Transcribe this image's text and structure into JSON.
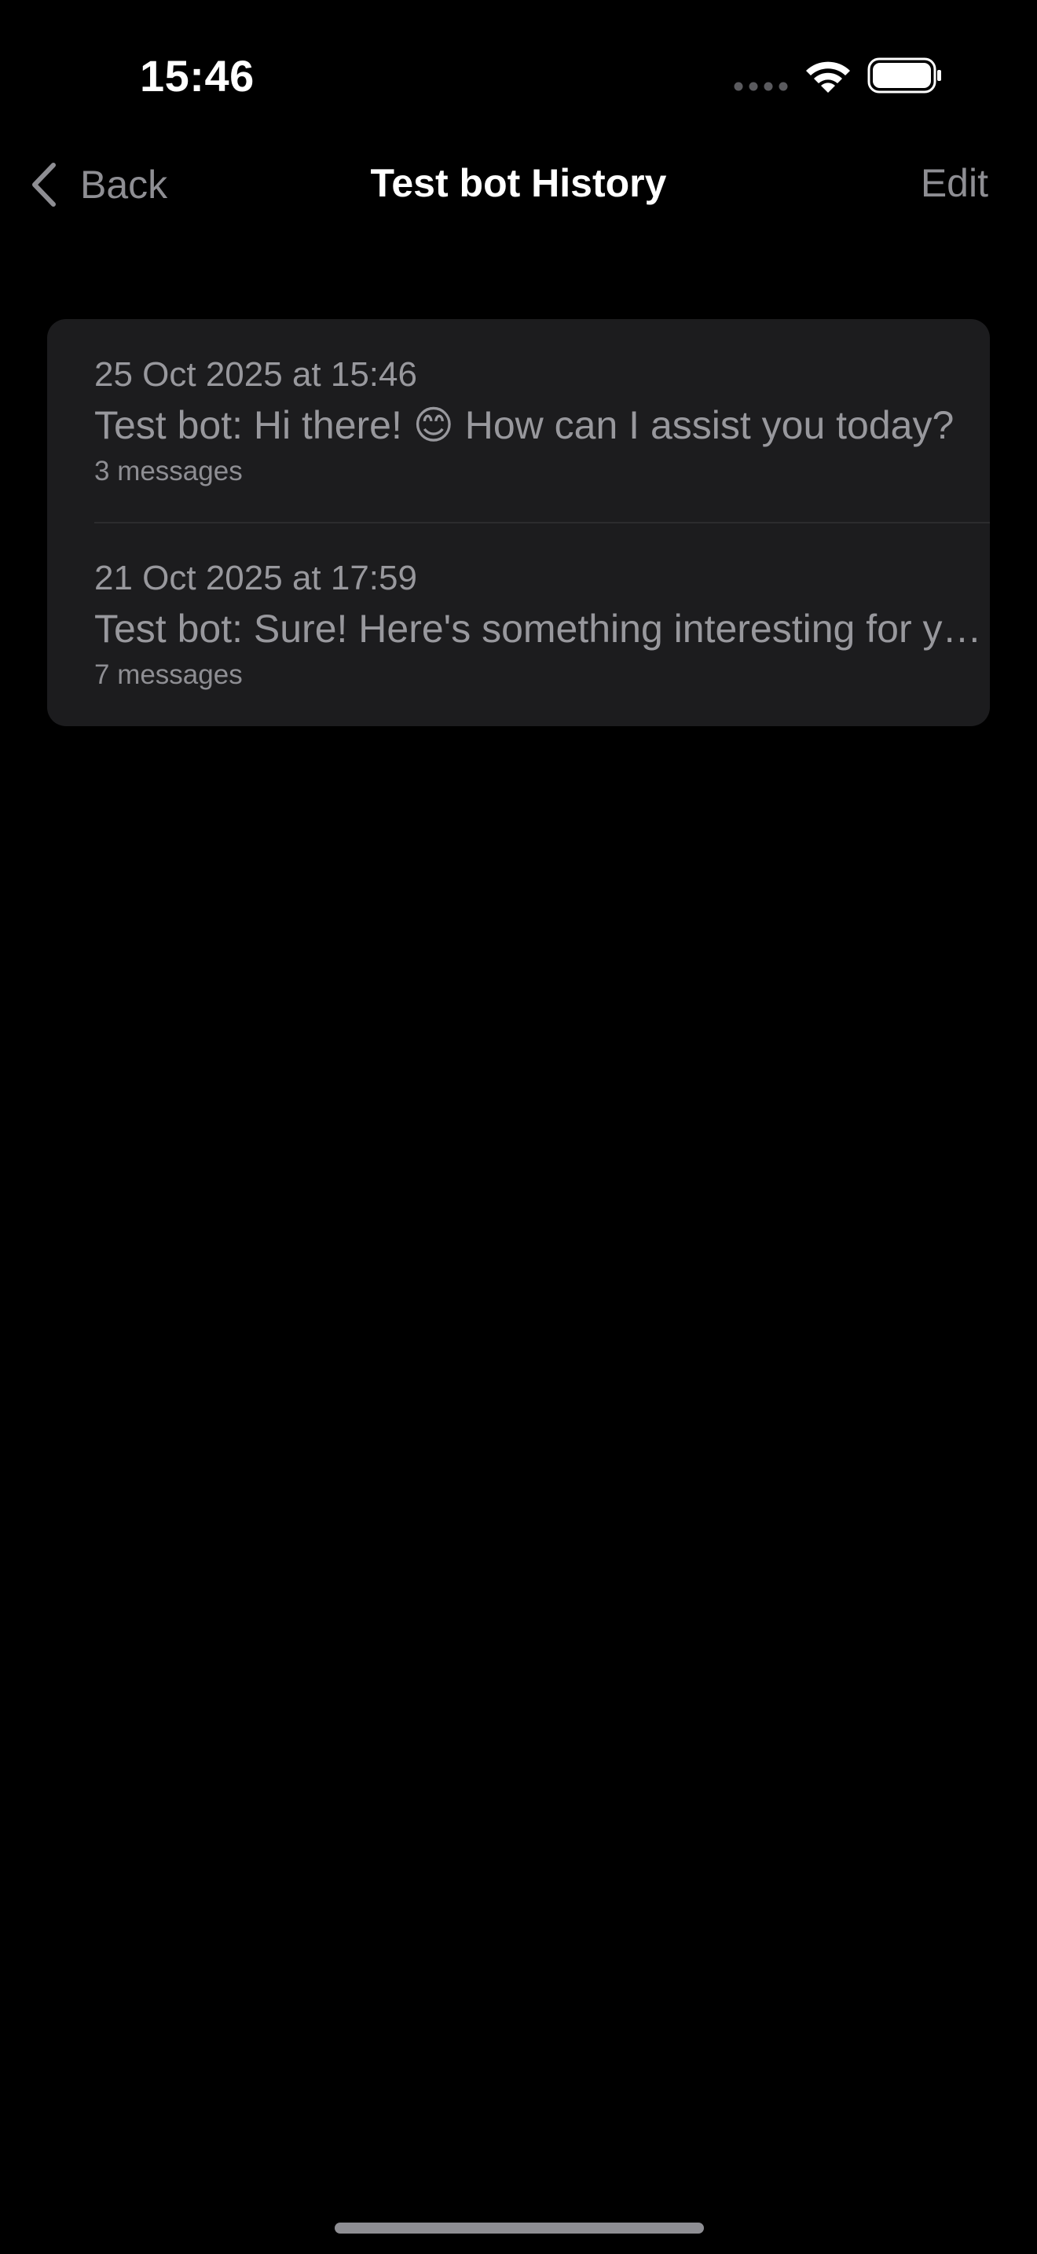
{
  "status_bar": {
    "time": "15:46",
    "icons": [
      "cellular-signal-icon",
      "wifi-icon",
      "battery-icon"
    ]
  },
  "nav": {
    "back_label": "Back",
    "title": "Test bot History",
    "edit_label": "Edit"
  },
  "history": {
    "items": [
      {
        "date": "25 Oct 2025 at 15:46",
        "preview": "Test bot: Hi there! 😊 How can I assist you today?",
        "count": "3 messages"
      },
      {
        "date": "21 Oct 2025 at 17:59",
        "preview": "Test bot: Sure! Here's something interesting for you",
        "count": "7 messages"
      }
    ]
  },
  "colors": {
    "background": "#000000",
    "card": "#1c1c1e",
    "secondary_text": "#8e8e93",
    "primary_text": "#ffffff"
  }
}
